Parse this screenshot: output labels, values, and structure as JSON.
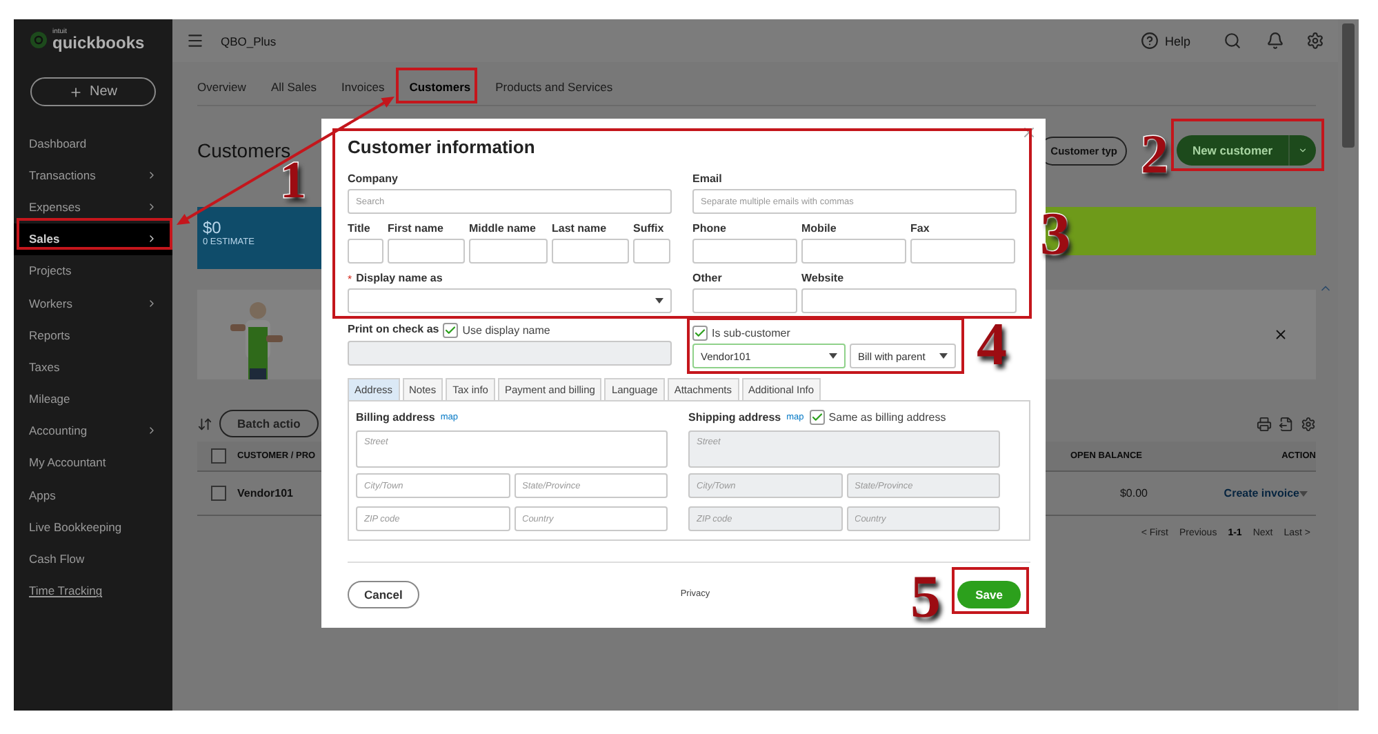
{
  "sidebar": {
    "brand_small": "intuit",
    "brand": "quickbooks",
    "new_button": "New",
    "items": [
      {
        "label": "Dashboard",
        "selected": false,
        "submenu": false,
        "underlined": false
      },
      {
        "label": "Transactions",
        "selected": false,
        "submenu": true,
        "underlined": false
      },
      {
        "label": "Expenses",
        "selected": false,
        "submenu": true,
        "underlined": false
      },
      {
        "label": "Sales",
        "selected": true,
        "submenu": true,
        "underlined": false
      },
      {
        "label": "Projects",
        "selected": false,
        "submenu": false,
        "underlined": false
      },
      {
        "label": "Workers",
        "selected": false,
        "submenu": true,
        "underlined": false
      },
      {
        "label": "Reports",
        "selected": false,
        "submenu": false,
        "underlined": false
      },
      {
        "label": "Taxes",
        "selected": false,
        "submenu": false,
        "underlined": false
      },
      {
        "label": "Mileage",
        "selected": false,
        "submenu": false,
        "underlined": false
      },
      {
        "label": "Accounting",
        "selected": false,
        "submenu": true,
        "underlined": false
      },
      {
        "label": "My Accountant",
        "selected": false,
        "submenu": false,
        "underlined": false
      },
      {
        "label": "Apps",
        "selected": false,
        "submenu": false,
        "underlined": false
      },
      {
        "label": "Live Bookkeeping",
        "selected": false,
        "submenu": false,
        "underlined": false
      },
      {
        "label": "Cash Flow",
        "selected": false,
        "submenu": false,
        "underlined": false
      },
      {
        "label": "Time Tracking",
        "selected": false,
        "submenu": false,
        "underlined": true
      }
    ]
  },
  "topbar": {
    "company": "QBO_Plus",
    "help": "Help"
  },
  "tabs": [
    {
      "label": "Overview",
      "selected": false
    },
    {
      "label": "All Sales",
      "selected": false
    },
    {
      "label": "Invoices",
      "selected": false
    },
    {
      "label": "Customers",
      "selected": true
    },
    {
      "label": "Products and Services",
      "selected": false
    }
  ],
  "page": {
    "title": "Customers",
    "customer_types_button": "Customer typ",
    "new_customer_button": "New customer",
    "estimate": {
      "amount": "$0",
      "label": "0 ESTIMATE"
    },
    "batch_actions": "Batch actio",
    "table": {
      "select_all_checked": false,
      "columns": [
        "CUSTOMER / PRO",
        "OPEN BALANCE",
        "ACTION"
      ],
      "rows": [
        {
          "customer": "Vendor101",
          "open_balance": "$0.00",
          "action": "Create invoice",
          "checked": false
        }
      ]
    },
    "pagination": {
      "first": "< First",
      "previous": "Previous",
      "range": "1-1",
      "next": "Next",
      "last": "Last >"
    }
  },
  "dialog": {
    "title": "Customer information",
    "company": {
      "label": "Company",
      "placeholder": "Search"
    },
    "name_fields": [
      {
        "label": "Title"
      },
      {
        "label": "First name"
      },
      {
        "label": "Middle name"
      },
      {
        "label": "Last name"
      },
      {
        "label": "Suffix"
      }
    ],
    "display_name": {
      "label": "Display name as",
      "required": true,
      "required_mark": "*"
    },
    "email": {
      "label": "Email",
      "placeholder": "Separate multiple emails with commas"
    },
    "phone_fields": [
      {
        "label": "Phone"
      },
      {
        "label": "Mobile"
      },
      {
        "label": "Fax"
      }
    ],
    "other_fields": [
      {
        "label": "Other"
      },
      {
        "label": "Website"
      }
    ],
    "print_on_check": {
      "label": "Print on check as",
      "option": "Use display name",
      "checked": true
    },
    "sub_customer": {
      "label": "Is sub-customer",
      "checked": true,
      "parent": "Vendor101",
      "billing": "Bill with parent"
    },
    "tabs": [
      {
        "label": "Address",
        "selected": true
      },
      {
        "label": "Notes",
        "selected": false
      },
      {
        "label": "Tax info",
        "selected": false
      },
      {
        "label": "Payment and billing",
        "selected": false
      },
      {
        "label": "Language",
        "selected": false
      },
      {
        "label": "Attachments",
        "selected": false
      },
      {
        "label": "Additional Info",
        "selected": false
      }
    ],
    "billing": {
      "title": "Billing address",
      "map": "map",
      "street": {
        "placeholder": "Street"
      },
      "city": {
        "placeholder": "City/Town"
      },
      "state": {
        "placeholder": "State/Province"
      },
      "zip": {
        "placeholder": "ZIP code"
      },
      "country": {
        "placeholder": "Country"
      }
    },
    "shipping": {
      "title": "Shipping address",
      "map": "map",
      "same_as_billing": "Same as billing address",
      "checked": true,
      "street": {
        "placeholder": "Street"
      },
      "city": {
        "placeholder": "City/Town"
      },
      "state": {
        "placeholder": "State/Province"
      },
      "zip": {
        "placeholder": "ZIP code"
      },
      "country": {
        "placeholder": "Country"
      }
    },
    "cancel": "Cancel",
    "privacy": "Privacy",
    "save": "Save"
  },
  "annotations": [
    {
      "number": "1"
    },
    {
      "number": "2"
    },
    {
      "number": "3"
    },
    {
      "number": "4"
    },
    {
      "number": "5"
    }
  ]
}
